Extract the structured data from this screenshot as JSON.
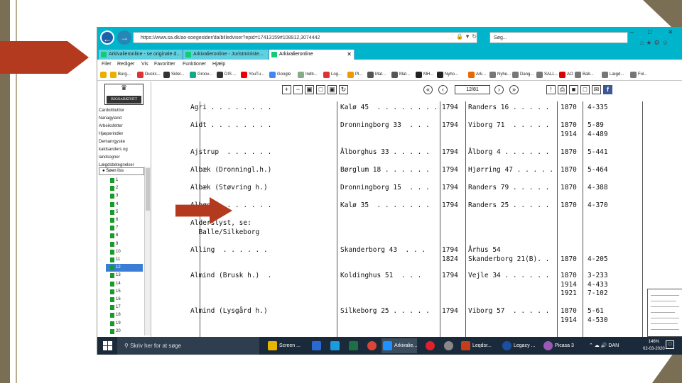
{
  "browser": {
    "url": "https://www.sa.dk/ao-soegesider/da/billedviser?epid=17413159#108912,3074442",
    "search_placeholder": "Søg...",
    "tabs": [
      {
        "label": "Arkivalieronline - se originale d..."
      },
      {
        "label": "Arkivalieronline - Juristministe..."
      },
      {
        "label": "Arkivalieronline"
      }
    ],
    "menu": [
      "Filer",
      "Rediger",
      "Vis",
      "Favoritter",
      "Funktioner",
      "Hjælp"
    ],
    "favorites": [
      "Burg...",
      "Ducks...",
      "Sidel...",
      "Groov...",
      "DIS ...",
      "YouTu...",
      "Google",
      "Indb...",
      "Log...",
      "Pl...",
      "Mat...",
      "Mat...",
      "MH...",
      "Nyho...",
      "Ark...",
      "Nyhe...",
      "Dang...",
      "SALL...",
      "AO",
      "Bab...",
      "Lægd...",
      "Fol..."
    ],
    "window_controls": [
      "–",
      "□",
      "✕"
    ]
  },
  "sidebar": {
    "logo_text": "RIGSARKIVET",
    "links": [
      "Cardoitbuttior",
      "Nanagyland",
      "Arbeiksfetter",
      "Hjæperindler",
      "Demanrgyske",
      "kaldsanders og",
      "landsogner",
      "Lægdsbetegnelser"
    ],
    "dropdown_label": "Søen liss",
    "tree": [
      "1",
      "2",
      "3",
      "4",
      "5",
      "6",
      "7",
      "8",
      "9",
      "10",
      "11",
      "12",
      "13",
      "14",
      "15",
      "16",
      "17",
      "18",
      "19",
      "20"
    ],
    "selected_index": 11
  },
  "viewer": {
    "page_indicator": "12/81"
  },
  "document": {
    "rows": [
      {
        "name": "Agri . . . . . . . .",
        "herred": "Kalø 45  . . . . . . . .",
        "year": "1794",
        "amt": "Randers 16 . . . . .",
        "y2": "1870",
        "ref": "4-335"
      },
      {
        "name": "Aidt . . . . . . . .",
        "herred": "Dronningborg 33  . . .",
        "year": "1794",
        "amt": "Viborg 71  . . . . .",
        "y2": "1870\n1914",
        "ref": "5-89\n4-489"
      },
      {
        "name": "Ajstrup  . . . . . .",
        "herred": "Ålborghus 33 . . . . .",
        "year": "1794",
        "amt": "Ålborg 4 . . . . . .",
        "y2": "1870",
        "ref": "5-441"
      },
      {
        "name": "Albæk (Dronningl.h.)",
        "herred": "Børglum 18 . . . . . .",
        "year": "1794",
        "amt": "Hjørring 47 . . . . .",
        "y2": "1870",
        "ref": "5-464"
      },
      {
        "name": "Albæk (Støvring h.)",
        "herred": "Dronningborg 15  . . .",
        "year": "1794",
        "amt": "Randers 79 . . . . .",
        "y2": "1870",
        "ref": "4-388"
      },
      {
        "name": "Albøge . . . . . . .",
        "herred": "Kalø 35  . . . . . . .",
        "year": "1794",
        "amt": "Randers 25 . . . . .",
        "y2": "1870",
        "ref": "4-370"
      },
      {
        "name": "Alderslyst, se:\n  Balle/Silkeborg",
        "herred": "",
        "year": "",
        "amt": "",
        "y2": "",
        "ref": ""
      },
      {
        "name": "Alling  . . . . . .",
        "herred": "Skanderborg 43  . . .",
        "year": "1794\n1824",
        "amt": "Århus 54\nSkanderborg 21(B). .",
        "y2": "\n1870",
        "ref": "\n4-205"
      },
      {
        "name": "Almind (Brusk h.)  .",
        "herred": "Koldinghus 51  . . .",
        "year": "1794",
        "amt": "Vejle 34 . . . . . .",
        "y2": "1870\n1914\n1921",
        "ref": "3-233\n4-433\n7-102"
      },
      {
        "name": "Almind (Lysgård h.)",
        "herred": "Silkeborg 25 . . . . .",
        "year": "1794",
        "amt": "Viborg 57  . . . . .",
        "y2": "1870\n1914",
        "ref": "5-61\n4-530"
      }
    ]
  },
  "taskbar": {
    "search_placeholder": "Skriv her for at søge",
    "apps": [
      "Screen ...",
      "Arkivalie...",
      "Leqdsr...",
      "Legacy ...",
      "Picasa 3"
    ],
    "tray_lang": "DAN",
    "zoom": "146%",
    "date": "02-03-2020"
  },
  "colors": {
    "accent_orange": "#b33a1f",
    "browser_cyan": "#00b4cc",
    "frame_brown": "#7a6f54",
    "taskbar": "#1b2a3a"
  }
}
